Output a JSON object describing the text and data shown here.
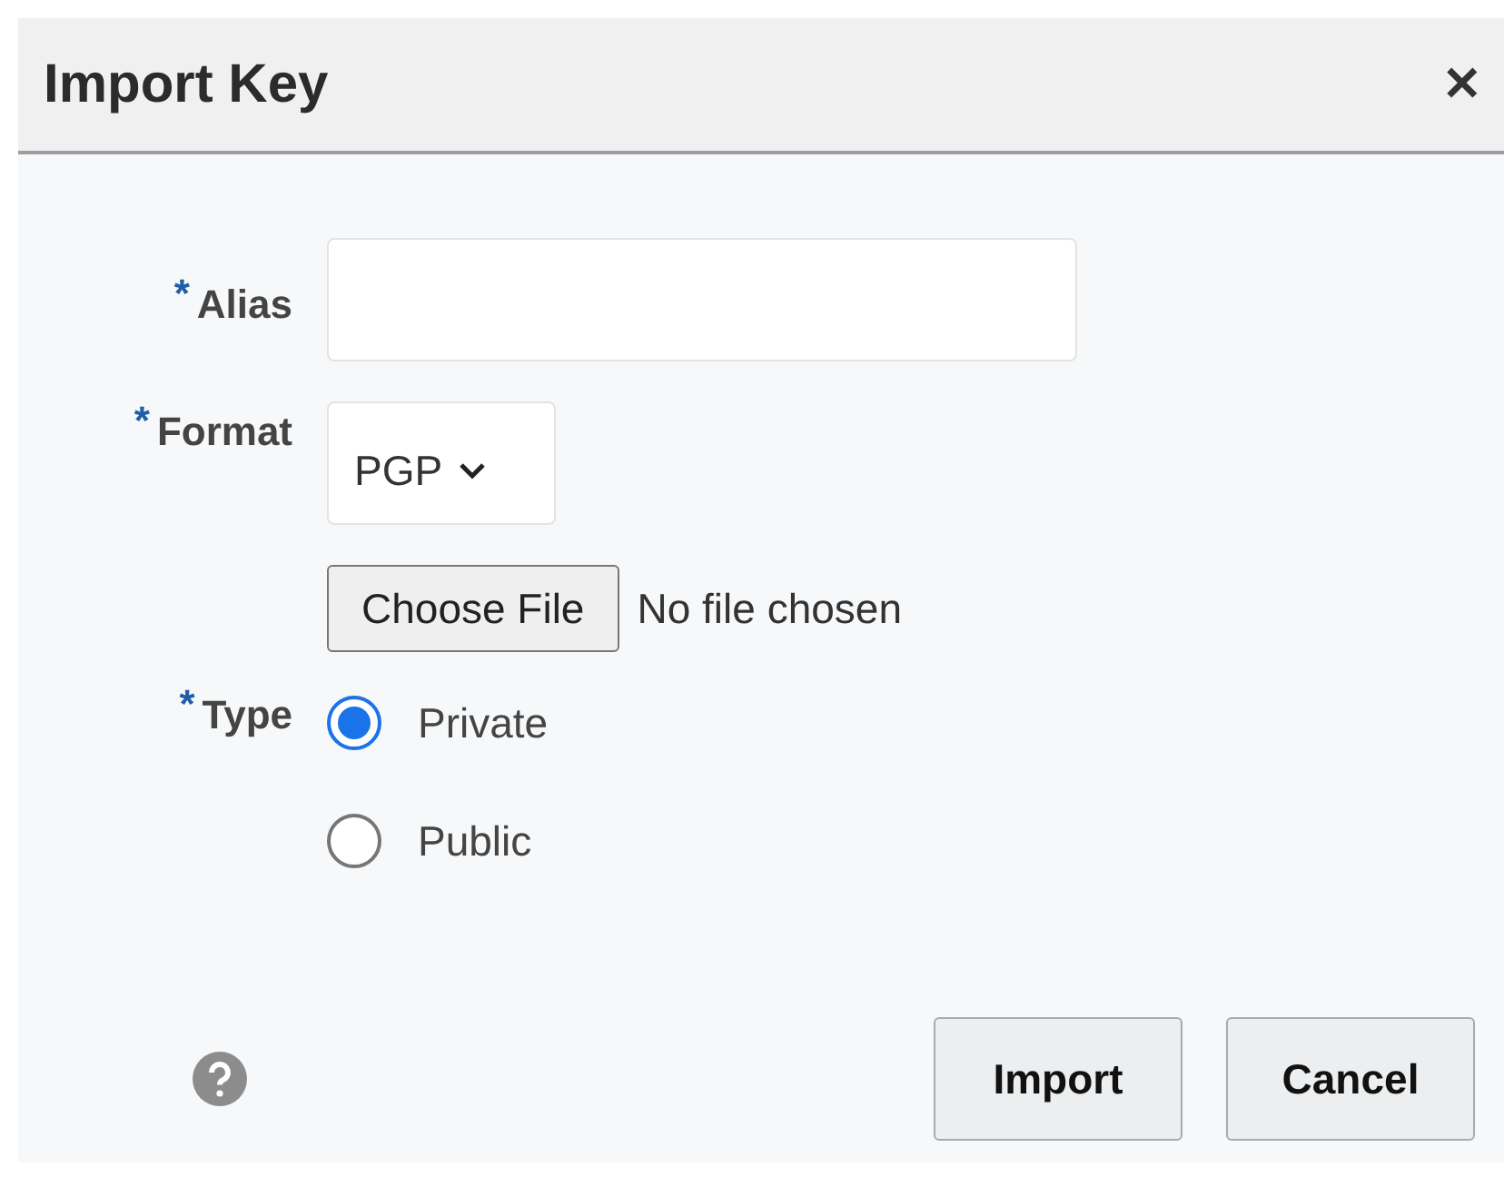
{
  "dialog": {
    "title": "Import Key",
    "close": "✕"
  },
  "fields": [
    {
      "kind": "text",
      "required_mark": "*",
      "label": "Alias"
    },
    {
      "kind": "select",
      "required_mark": "*",
      "label": "Format",
      "value": "PGP"
    },
    {
      "kind": "file",
      "button": "Choose File",
      "status": "No file chosen"
    },
    {
      "kind": "radio",
      "required_mark": "*",
      "label": "Type",
      "options": [
        {
          "label": "Private",
          "selected": true
        },
        {
          "label": "Public",
          "selected": false
        }
      ]
    }
  ],
  "buttons": [
    "Import",
    "Cancel"
  ]
}
